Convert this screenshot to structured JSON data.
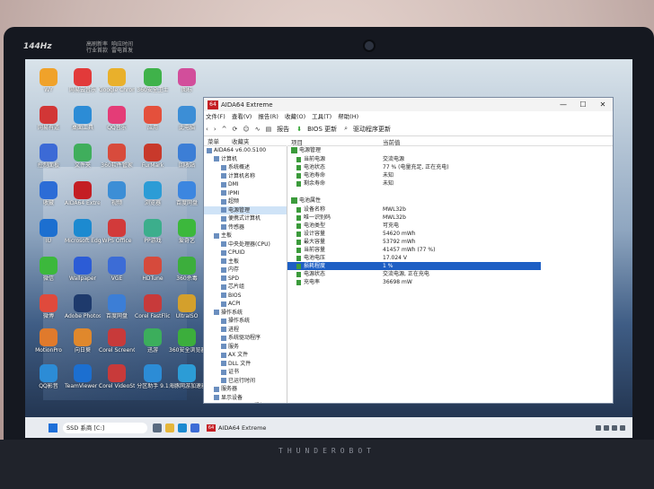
{
  "bezel": {
    "hz_badge": "144Hz",
    "note_left": [
      "高刷新率",
      "行业首款"
    ],
    "note_right": [
      "响应时间",
      "雷电首发"
    ],
    "brand": "THUNDEROBOT"
  },
  "desktop_icons": [
    {
      "label": "WY",
      "color": "#f0a22a"
    },
    {
      "label": "网易云音乐",
      "color": "#e23a3a"
    },
    {
      "label": "Google Chrome",
      "color": "#e9b02b"
    },
    {
      "label": "360安全卫士",
      "color": "#3fb24a"
    },
    {
      "label": "图标",
      "color": "#d24e9b"
    },
    {
      "label": "网易有道",
      "color": "#d23636"
    },
    {
      "label": "桌面工具",
      "color": "#2c8cd6"
    },
    {
      "label": "QQ音乐",
      "color": "#e43c77"
    },
    {
      "label": "应用",
      "color": "#e4503c"
    },
    {
      "label": "此电脑",
      "color": "#3c8ed6"
    },
    {
      "label": "控制面板",
      "color": "#3c6ad6"
    },
    {
      "label": "文件夹",
      "color": "#3fae5c"
    },
    {
      "label": "360软件管家",
      "color": "#d84b3c"
    },
    {
      "label": "FurMark",
      "color": "#c8392b"
    },
    {
      "label": "回收站",
      "color": "#3c7ed6"
    },
    {
      "label": "收藏",
      "color": "#2c6cd6"
    },
    {
      "label": "AIDA64 Extreme",
      "color": "#c41e24"
    },
    {
      "label": "视频",
      "color": "#3c8ed6"
    },
    {
      "label": "浏览器",
      "color": "#2c9cd6"
    },
    {
      "label": "百度网盘",
      "color": "#3c86e0"
    },
    {
      "label": "IU",
      "color": "#1c6fd0"
    },
    {
      "label": "Microsoft Edge",
      "color": "#1c8ad0"
    },
    {
      "label": "WPS Office",
      "color": "#d23a3a"
    },
    {
      "label": "PP游戏",
      "color": "#3cae8c"
    },
    {
      "label": "爱奇艺",
      "color": "#3cb83c"
    },
    {
      "label": "微信",
      "color": "#3cb83c"
    },
    {
      "label": "Wallpaper",
      "color": "#2c5cd6"
    },
    {
      "label": "VGE",
      "color": "#3c6cd6"
    },
    {
      "label": "HDTune",
      "color": "#d64a3c"
    },
    {
      "label": "360杀毒",
      "color": "#3cae3c"
    },
    {
      "label": "微博",
      "color": "#e04a3c"
    },
    {
      "label": "Adobe Photosh...",
      "color": "#1e3a6c"
    },
    {
      "label": "百度网盘",
      "color": "#3c7ed6"
    },
    {
      "label": "Corel FastFlick X9",
      "color": "#c83a3a"
    },
    {
      "label": "UltraISO",
      "color": "#d4a02c"
    },
    {
      "label": "MotionPro",
      "color": "#e07a2c"
    },
    {
      "label": "向日葵",
      "color": "#e0882c"
    },
    {
      "label": "Corel ScreenC...",
      "color": "#c83a3a"
    },
    {
      "label": "迅游",
      "color": "#3cae5c"
    },
    {
      "label": "360安全浏览器",
      "color": "#3cae3c"
    },
    {
      "label": "QQ影音",
      "color": "#2c8cd6"
    },
    {
      "label": "TeamViewer 14",
      "color": "#1c6fd0"
    },
    {
      "label": "Corel VideoStud...",
      "color": "#c83a3a"
    },
    {
      "label": "分区助手 9.1",
      "color": "#2c8cd6"
    },
    {
      "label": "海豚网游加速器",
      "color": "#2c9cd6"
    },
    {
      "label": "Wireshark",
      "color": "#2c6cd6"
    },
    {
      "label": "Navicat",
      "color": "#3c8ed6"
    }
  ],
  "window": {
    "title": "AIDA64 Extreme",
    "menu": [
      "文件(F)",
      "查看(V)",
      "报告(R)",
      "收藏(O)",
      "工具(T)",
      "帮助(H)"
    ],
    "toolbar": {
      "report": "报告",
      "bios": "BIOS 更新",
      "driver": "驱动程序更新"
    },
    "left_tabs": [
      "菜单",
      "收藏夹"
    ],
    "tree": [
      {
        "label": "AIDA64 v6.00.5100",
        "indent": 0
      },
      {
        "label": "计算机",
        "indent": 1
      },
      {
        "label": "系统概述",
        "indent": 2
      },
      {
        "label": "计算机名称",
        "indent": 2
      },
      {
        "label": "DMI",
        "indent": 2
      },
      {
        "label": "IPMI",
        "indent": 2
      },
      {
        "label": "超频",
        "indent": 2
      },
      {
        "label": "电源管理",
        "indent": 2,
        "selected": true
      },
      {
        "label": "便携式计算机",
        "indent": 2
      },
      {
        "label": "传感器",
        "indent": 2
      },
      {
        "label": "主板",
        "indent": 1
      },
      {
        "label": "中央处理器(CPU)",
        "indent": 2
      },
      {
        "label": "CPUID",
        "indent": 2
      },
      {
        "label": "主板",
        "indent": 2
      },
      {
        "label": "内存",
        "indent": 2
      },
      {
        "label": "SPD",
        "indent": 2
      },
      {
        "label": "芯片组",
        "indent": 2
      },
      {
        "label": "BIOS",
        "indent": 2
      },
      {
        "label": "ACPI",
        "indent": 2
      },
      {
        "label": "操作系统",
        "indent": 1
      },
      {
        "label": "操作系统",
        "indent": 2
      },
      {
        "label": "进程",
        "indent": 2
      },
      {
        "label": "系统驱动程序",
        "indent": 2
      },
      {
        "label": "服务",
        "indent": 2
      },
      {
        "label": "AX 文件",
        "indent": 2
      },
      {
        "label": "DLL 文件",
        "indent": 2
      },
      {
        "label": "证书",
        "indent": 2
      },
      {
        "label": "已运行时间",
        "indent": 2
      },
      {
        "label": "服务器",
        "indent": 1
      },
      {
        "label": "显示设备",
        "indent": 1
      },
      {
        "label": "Windows 视频",
        "indent": 2
      }
    ],
    "columns": {
      "item": "项目",
      "value": "当前值"
    },
    "sections": [
      {
        "title": "电源管理",
        "rows": [
          {
            "k": "当前电源",
            "v": "交流电源"
          },
          {
            "k": "电池状态",
            "v": "77 % (电量充足, 正在充电)"
          },
          {
            "k": "电池寿命",
            "v": "未知"
          },
          {
            "k": "剩余寿命",
            "v": "未知"
          }
        ]
      },
      {
        "title": "电池属性",
        "rows": [
          {
            "k": "设备名称",
            "v": "MWL32b"
          },
          {
            "k": "唯一识别码",
            "v": "MWL32b"
          },
          {
            "k": "电池类型",
            "v": "可充电"
          },
          {
            "k": "设计容量",
            "v": "54620 mWh"
          },
          {
            "k": "最大容量",
            "v": "53792 mWh"
          },
          {
            "k": "当前容量",
            "v": "41457 mWh (77 %)"
          },
          {
            "k": "电池电压",
            "v": "17.024 V"
          },
          {
            "k": "损耗程度",
            "v": "1 %",
            "selected": true
          },
          {
            "k": "电源状态",
            "v": "交流电源, 正在充电"
          },
          {
            "k": "充电率",
            "v": "36698 mW"
          }
        ]
      }
    ]
  },
  "taskbar": {
    "search_text": "SSD 系商 [C:]",
    "app": "AIDA64 Extreme"
  }
}
